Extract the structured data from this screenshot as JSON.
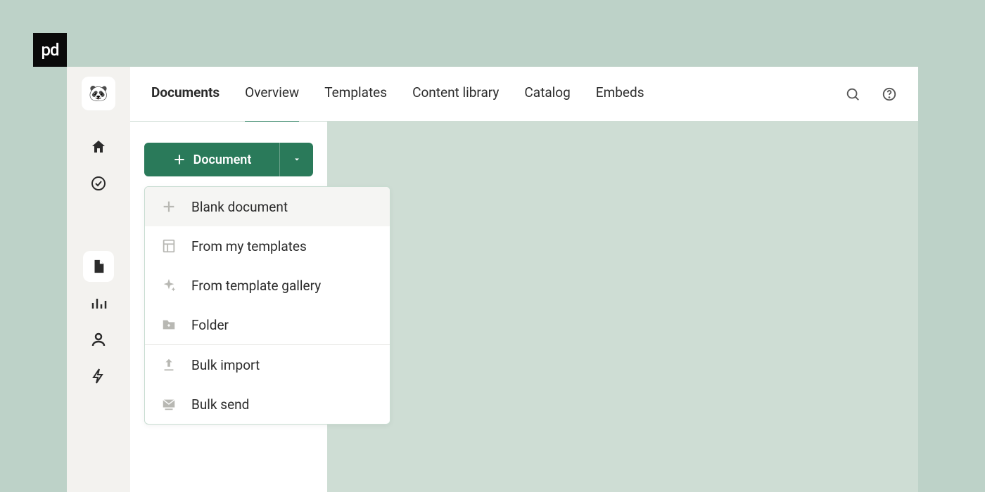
{
  "brand_badge": "pd",
  "tabs": {
    "documents": "Documents",
    "overview": "Overview",
    "templates": "Templates",
    "content_library": "Content library",
    "catalog": "Catalog",
    "embeds": "Embeds"
  },
  "create_button": {
    "label": "Document"
  },
  "dropdown": {
    "blank_document": "Blank document",
    "from_my_templates": "From my templates",
    "from_template_gallery": "From template gallery",
    "folder": "Folder",
    "bulk_import": "Bulk import",
    "bulk_send": "Bulk send"
  }
}
